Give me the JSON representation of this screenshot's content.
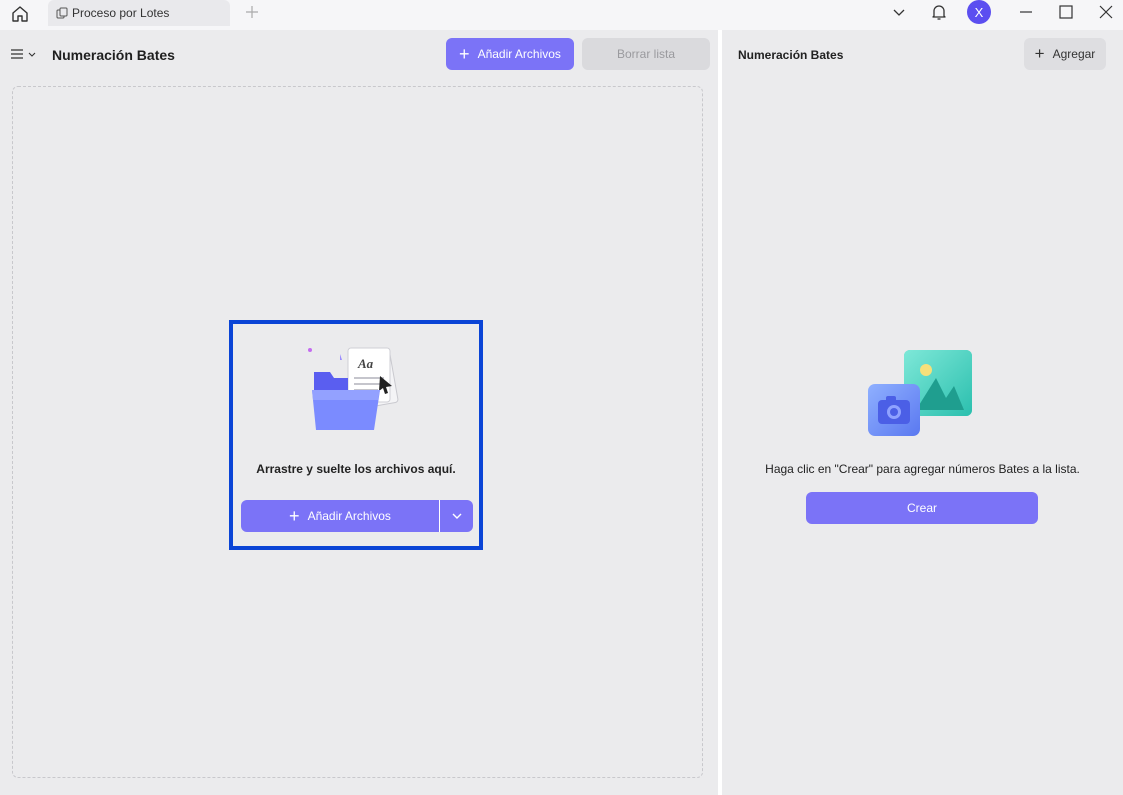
{
  "titlebar": {
    "tab_label": "Proceso por Lotes",
    "avatar_initial": "X"
  },
  "left": {
    "title": "Numeración Bates",
    "add_files_label": "Añadir Archivos",
    "clear_list_label": "Borrar lista",
    "drop_text": "Arrastre y suelte los archivos aquí.",
    "drop_add_files_label": "Añadir Archivos"
  },
  "right": {
    "title": "Numeración Bates",
    "add_label": "Agregar",
    "hint": "Haga clic en \"Crear\" para agregar números Bates a la lista.",
    "create_label": "Crear"
  },
  "colors": {
    "accent": "#7b73f7",
    "highlight": "#0a44d6"
  }
}
